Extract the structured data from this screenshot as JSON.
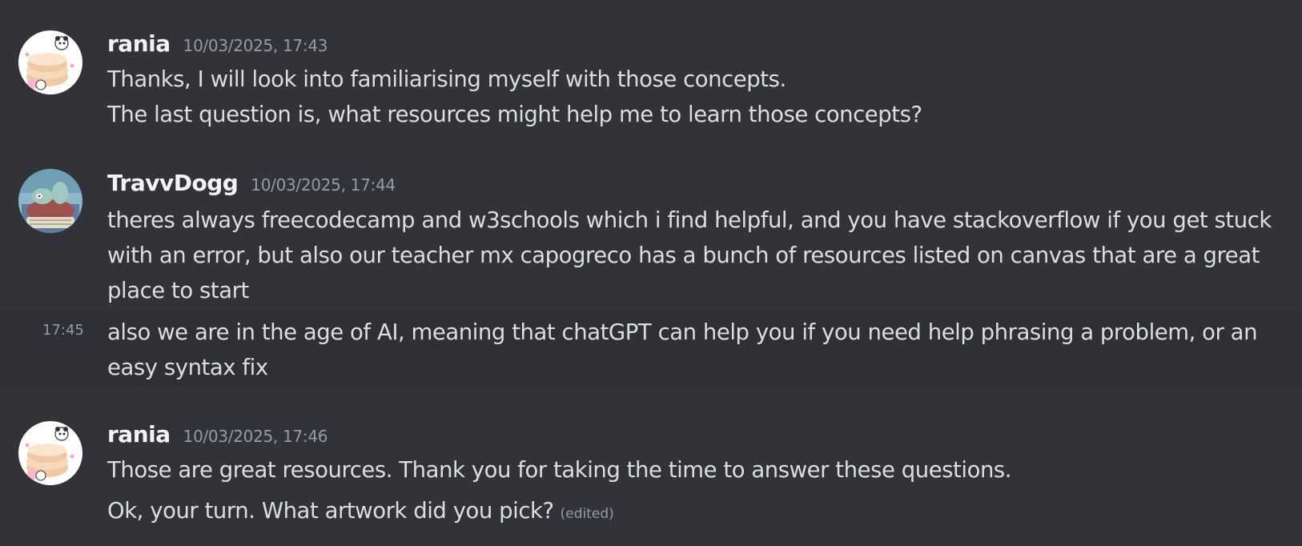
{
  "messages": [
    {
      "username": "rania",
      "timestamp": "10/03/2025, 17:43",
      "avatar": "panda-pancake-avatar",
      "lines": [
        "Thanks, I will look into familiarising myself with those concepts.",
        "The last question is, what resources might help me to learn those concepts?"
      ]
    },
    {
      "username": "TravvDogg",
      "timestamp": "10/03/2025, 17:44",
      "avatar": "squidward-avatar",
      "text": "theres always freecodecamp and w3schools which i find helpful, and you have stackoverflow if you get stuck with an error, but also our teacher mx capogreco has a bunch of resources listed on canvas that are a great place to start",
      "followup": {
        "time": "17:45",
        "text": "also we are in the age of AI, meaning that chatGPT can help you if you need help phrasing a problem, or an easy syntax fix"
      }
    },
    {
      "username": "rania",
      "timestamp": "10/03/2025, 17:46",
      "avatar": "panda-pancake-avatar",
      "lines": [
        "Those are great resources. Thank you for taking the time to answer these questions.",
        "Ok, your turn. What artwork did you pick?"
      ],
      "edited_label": "(edited)"
    }
  ],
  "colors": {
    "background": "#313338",
    "hover_background": "#2e3035",
    "username": "#f2f3f5",
    "text": "#dbdee1",
    "muted": "#949ba4"
  }
}
